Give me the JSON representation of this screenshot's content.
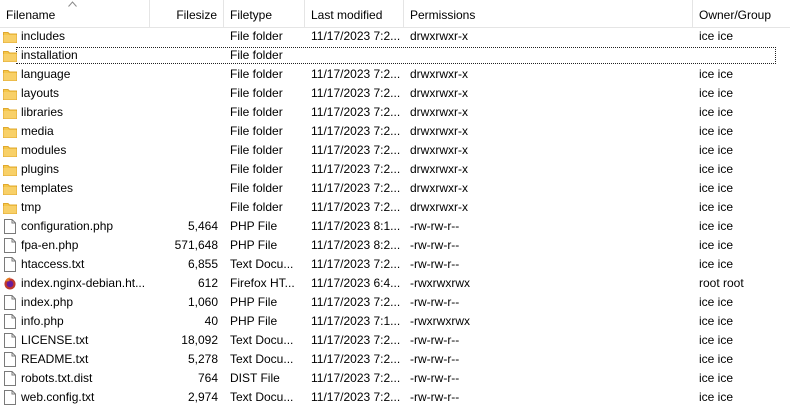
{
  "columns": {
    "filename": "Filename",
    "filesize": "Filesize",
    "filetype": "Filetype",
    "last_modified": "Last modified",
    "permissions": "Permissions",
    "owner_group": "Owner/Group"
  },
  "files": [
    {
      "name": "includes",
      "size": "",
      "type": "File folder",
      "modified": "11/17/2023 7:2...",
      "perms": "drwxrwxr-x",
      "owner": "ice ice",
      "icon": "folder-icon"
    },
    {
      "name": "installation",
      "size": "",
      "type": "File folder",
      "modified": "",
      "perms": "",
      "owner": "",
      "icon": "folder-icon"
    },
    {
      "name": "language",
      "size": "",
      "type": "File folder",
      "modified": "11/17/2023 7:2...",
      "perms": "drwxrwxr-x",
      "owner": "ice ice",
      "icon": "folder-icon"
    },
    {
      "name": "layouts",
      "size": "",
      "type": "File folder",
      "modified": "11/17/2023 7:2...",
      "perms": "drwxrwxr-x",
      "owner": "ice ice",
      "icon": "folder-icon"
    },
    {
      "name": "libraries",
      "size": "",
      "type": "File folder",
      "modified": "11/17/2023 7:2...",
      "perms": "drwxrwxr-x",
      "owner": "ice ice",
      "icon": "folder-icon"
    },
    {
      "name": "media",
      "size": "",
      "type": "File folder",
      "modified": "11/17/2023 7:2...",
      "perms": "drwxrwxr-x",
      "owner": "ice ice",
      "icon": "folder-icon"
    },
    {
      "name": "modules",
      "size": "",
      "type": "File folder",
      "modified": "11/17/2023 7:2...",
      "perms": "drwxrwxr-x",
      "owner": "ice ice",
      "icon": "folder-icon"
    },
    {
      "name": "plugins",
      "size": "",
      "type": "File folder",
      "modified": "11/17/2023 7:2...",
      "perms": "drwxrwxr-x",
      "owner": "ice ice",
      "icon": "folder-icon"
    },
    {
      "name": "templates",
      "size": "",
      "type": "File folder",
      "modified": "11/17/2023 7:2...",
      "perms": "drwxrwxr-x",
      "owner": "ice ice",
      "icon": "folder-icon"
    },
    {
      "name": "tmp",
      "size": "",
      "type": "File folder",
      "modified": "11/17/2023 7:2...",
      "perms": "drwxrwxr-x",
      "owner": "ice ice",
      "icon": "folder-icon"
    },
    {
      "name": "configuration.php",
      "size": "5,464",
      "type": "PHP File",
      "modified": "11/17/2023 8:1...",
      "perms": "-rw-rw-r--",
      "owner": "ice ice",
      "icon": "file-icon"
    },
    {
      "name": "fpa-en.php",
      "size": "571,648",
      "type": "PHP File",
      "modified": "11/17/2023 8:2...",
      "perms": "-rw-rw-r--",
      "owner": "ice ice",
      "icon": "file-icon"
    },
    {
      "name": "htaccess.txt",
      "size": "6,855",
      "type": "Text Docu...",
      "modified": "11/17/2023 7:2...",
      "perms": "-rw-rw-r--",
      "owner": "ice ice",
      "icon": "file-icon"
    },
    {
      "name": "index.nginx-debian.ht...",
      "size": "612",
      "type": "Firefox HT...",
      "modified": "11/17/2023 6:4...",
      "perms": "-rwxrwxrwx",
      "owner": "root root",
      "icon": "firefox-icon"
    },
    {
      "name": "index.php",
      "size": "1,060",
      "type": "PHP File",
      "modified": "11/17/2023 7:2...",
      "perms": "-rw-rw-r--",
      "owner": "ice ice",
      "icon": "file-icon"
    },
    {
      "name": "info.php",
      "size": "40",
      "type": "PHP File",
      "modified": "11/17/2023 7:1...",
      "perms": "-rwxrwxrwx",
      "owner": "ice ice",
      "icon": "file-icon"
    },
    {
      "name": "LICENSE.txt",
      "size": "18,092",
      "type": "Text Docu...",
      "modified": "11/17/2023 7:2...",
      "perms": "-rw-rw-r--",
      "owner": "ice ice",
      "icon": "file-icon"
    },
    {
      "name": "README.txt",
      "size": "5,278",
      "type": "Text Docu...",
      "modified": "11/17/2023 7:2...",
      "perms": "-rw-rw-r--",
      "owner": "ice ice",
      "icon": "file-icon"
    },
    {
      "name": "robots.txt.dist",
      "size": "764",
      "type": "DIST File",
      "modified": "11/17/2023 7:2...",
      "perms": "-rw-rw-r--",
      "owner": "ice ice",
      "icon": "file-icon"
    },
    {
      "name": "web.config.txt",
      "size": "2,974",
      "type": "Text Docu...",
      "modified": "11/17/2023 7:2...",
      "perms": "-rw-rw-r--",
      "owner": "ice ice",
      "icon": "file-icon"
    }
  ],
  "focused_index": 1,
  "colors": {
    "folder": "#f5c74a",
    "folder_dark": "#e0a82e",
    "header_divider": "#e5e5e5"
  }
}
